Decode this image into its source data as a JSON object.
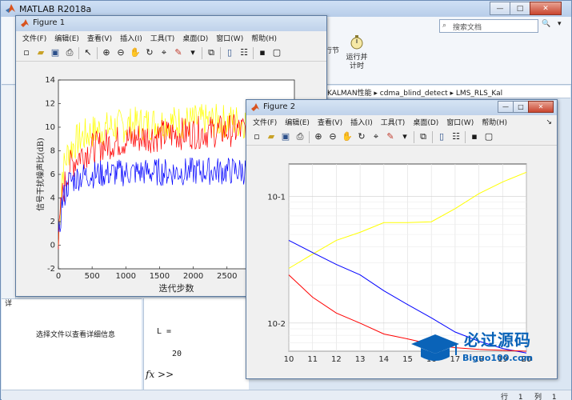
{
  "matlab": {
    "title": "MATLAB R2018a",
    "search_placeholder": "搜索文档",
    "ribbon_run_section": "行节",
    "ribbon_run_time_line1": "运行并",
    "ribbon_run_time_line2": "计时",
    "address_path": "KALMAN性能 ▸ cdma_blind_detect ▸ LMS_RLS_Kal",
    "left_tab_label": "详",
    "details_hint": "选择文件以查看详细信息",
    "cmd_output_line1": "L =",
    "cmd_output_line2": "20",
    "cmd_prompt": "fx >>",
    "status_row_label": "行",
    "status_row_value": "1",
    "status_col_label": "列",
    "status_col_value": "1"
  },
  "figure1": {
    "title": "Figure 1",
    "menus": [
      "文件(F)",
      "编辑(E)",
      "查看(V)",
      "插入(I)",
      "工具(T)",
      "桌面(D)",
      "窗口(W)",
      "帮助(H)"
    ]
  },
  "figure2": {
    "title": "Figure 2",
    "menus": [
      "文件(F)",
      "编辑(E)",
      "查看(V)",
      "插入(I)",
      "工具(T)",
      "桌面(D)",
      "窗口(W)",
      "帮助(H)"
    ]
  },
  "watermark": {
    "title": "必过源码",
    "subtitle": "Biguo100.com"
  },
  "chart_data": [
    {
      "type": "line",
      "title": "",
      "xlabel": "迭代步数",
      "ylabel": "信号干扰噪声比(dB)",
      "xlim": [
        0,
        3500
      ],
      "ylim": [
        -2,
        14
      ],
      "xticks": [
        0,
        500,
        1000,
        1500,
        2000,
        2500,
        3000
      ],
      "yticks": [
        -2,
        0,
        2,
        4,
        6,
        8,
        10,
        12,
        14
      ],
      "grid": false,
      "series": [
        {
          "color": "#ffff00",
          "x": [
            0,
            50,
            150,
            300,
            500,
            800,
            1200,
            1700,
            2200,
            2800,
            3500
          ],
          "values": [
            0,
            6,
            8,
            9,
            9.6,
            10,
            10.3,
            10.4,
            10.5,
            10.5,
            10.5
          ]
        },
        {
          "color": "#ff0000",
          "x": [
            0,
            50,
            150,
            300,
            500,
            800,
            1200,
            1700,
            2200,
            2800,
            3500
          ],
          "values": [
            0,
            4,
            6.5,
            7.6,
            8.2,
            8.7,
            9.1,
            9.4,
            9.6,
            9.8,
            9.9
          ]
        },
        {
          "color": "#0000ff",
          "x": [
            0,
            50,
            150,
            300,
            500,
            800,
            1200,
            1700,
            2200,
            2800,
            3500
          ],
          "values": [
            0,
            3.5,
            5.3,
            5.8,
            6,
            6.1,
            6.2,
            6.2,
            6.3,
            6.3,
            6.3
          ]
        }
      ]
    },
    {
      "type": "line",
      "title": "",
      "xlabel": "",
      "ylabel": "",
      "xlim": [
        10,
        20
      ],
      "yscale": "log",
      "ylim": [
        0.006,
        0.18
      ],
      "xticks": [
        10,
        11,
        12,
        13,
        14,
        15,
        16,
        17,
        18,
        19,
        20
      ],
      "ytick_labels": [
        "10-1",
        "10-2"
      ],
      "grid": true,
      "x": [
        10,
        11,
        12,
        13,
        14,
        15,
        16,
        17,
        18,
        19,
        20
      ],
      "series": [
        {
          "color": "#ffff00",
          "values": [
            0.027,
            0.035,
            0.045,
            0.052,
            0.062,
            0.062,
            0.063,
            0.08,
            0.105,
            0.13,
            0.155
          ]
        },
        {
          "color": "#0000ff",
          "values": [
            0.045,
            0.036,
            0.029,
            0.024,
            0.018,
            0.014,
            0.011,
            0.0085,
            0.0072,
            0.0063,
            0.0058
          ]
        },
        {
          "color": "#ff0000",
          "values": [
            0.024,
            0.016,
            0.012,
            0.01,
            0.0082,
            0.0075,
            0.0068,
            0.0064,
            0.0062,
            0.0061,
            0.006
          ]
        }
      ]
    }
  ]
}
